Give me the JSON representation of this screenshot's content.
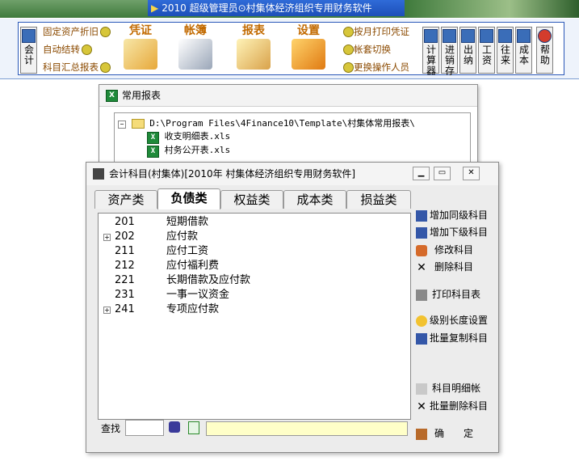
{
  "app": {
    "title_bar": "2010  超级管理员⊙村集体经济组织专用财务软件"
  },
  "toolbar": {
    "left_btn": "会计",
    "small_left": [
      "固定资产折旧",
      "自动结转",
      "科目汇总报表"
    ],
    "big": [
      "凭证",
      "帐簿",
      "报表",
      "设置"
    ],
    "small_right": [
      "按月打印凭证",
      "帐套切换",
      "更换操作人员"
    ],
    "vertical": [
      "计算器",
      "进销存",
      "出纳",
      "工资",
      "往来",
      "成本",
      "帮助"
    ]
  },
  "report_window": {
    "title": "常用报表",
    "path": "D:\\Program Files\\4Finance10\\Template\\村集体常用报表\\",
    "files": [
      "收支明细表.xls",
      "村务公开表.xls"
    ]
  },
  "main_window": {
    "title": "会计科目(村集体)[2010年 村集体经济组织专用财务软件]",
    "tabs": [
      "资产类",
      "负债类",
      "权益类",
      "成本类",
      "损益类"
    ],
    "active_tab": "负债类",
    "rows": [
      {
        "code": "201",
        "name": "短期借款",
        "expandable": false
      },
      {
        "code": "202",
        "name": "应付款",
        "expandable": true
      },
      {
        "code": "211",
        "name": "应付工资",
        "expandable": false
      },
      {
        "code": "212",
        "name": "应付福利费",
        "expandable": false
      },
      {
        "code": "221",
        "name": "长期借款及应付款",
        "expandable": false
      },
      {
        "code": "231",
        "name": "一事一议资金",
        "expandable": false
      },
      {
        "code": "241",
        "name": "专项应付款",
        "expandable": true
      }
    ],
    "actions": {
      "add_same": "增加同级科目",
      "add_sub": "增加下级科目",
      "edit": "修改科目",
      "delete": "删除科目",
      "print": "打印科目表",
      "level_setting": "级别长度设置",
      "batch_copy": "批量复制科目",
      "detail": "科目明细帐",
      "batch_delete": "批量删除科目",
      "ok": "确　　定"
    },
    "search_label": "查找"
  }
}
